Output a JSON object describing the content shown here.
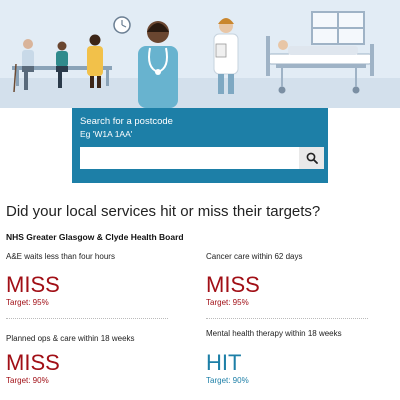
{
  "search": {
    "title": "Search for a postcode",
    "hint": "Eg 'W1A 1AA'",
    "placeholder": "",
    "button_icon": "search-icon"
  },
  "heading": "Did your local services hit or miss their targets?",
  "board": "NHS Greater Glasgow & Clyde Health Board",
  "colors": {
    "miss": "#a10f16",
    "hit": "#1d7fa7",
    "search_bg": "#1d7fa7"
  },
  "cards": [
    {
      "label": "A&E waits less than four hours",
      "result": "MISS",
      "target": "Target: 95%"
    },
    {
      "label": "Cancer care within 62 days",
      "result": "MISS",
      "target": "Target: 95%"
    },
    {
      "label": "Planned ops & care within 18 weeks",
      "result": "MISS",
      "target": "Target: 90%"
    },
    {
      "label": "Mental health therapy within 18 weeks",
      "result": "HIT",
      "target": "Target: 90%"
    }
  ]
}
